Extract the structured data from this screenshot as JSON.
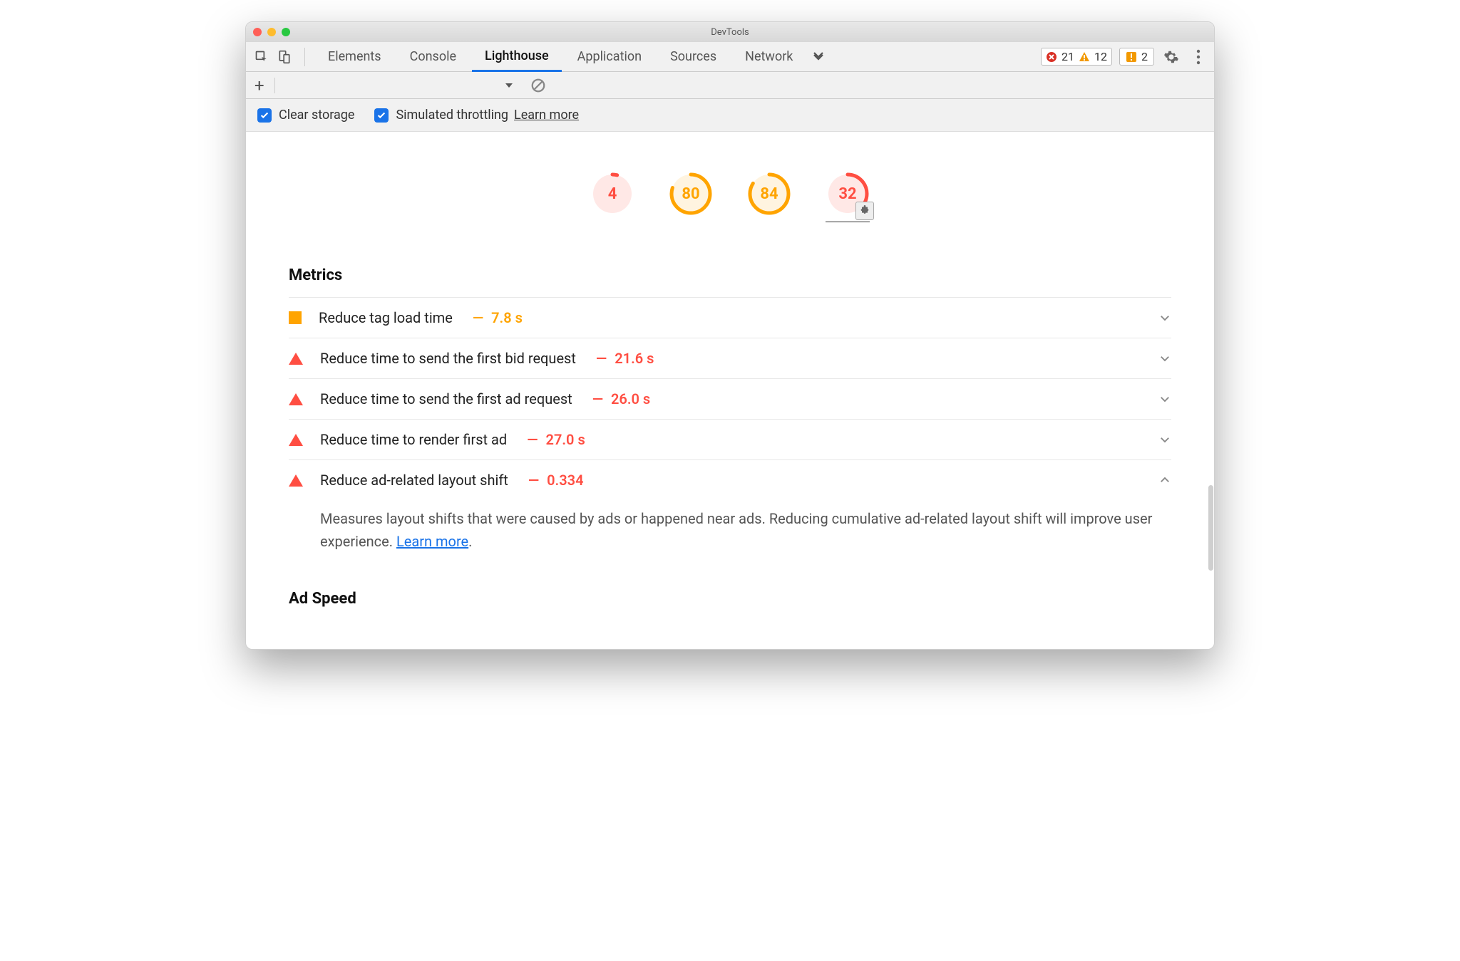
{
  "window": {
    "title": "DevTools"
  },
  "tabs": {
    "items": [
      "Elements",
      "Console",
      "Lighthouse",
      "Application",
      "Sources",
      "Network"
    ],
    "activeIndex": 2
  },
  "status": {
    "errors": "21",
    "warnings": "12",
    "issues": "2"
  },
  "options": {
    "clearStorage": "Clear storage",
    "simulatedThrottling": "Simulated throttling",
    "learnMore": "Learn more"
  },
  "scores": [
    {
      "value": "4",
      "level": "fail",
      "pct": 4
    },
    {
      "value": "80",
      "level": "avg",
      "pct": 80
    },
    {
      "value": "84",
      "level": "avg",
      "pct": 84
    },
    {
      "value": "32",
      "level": "fail",
      "pct": 32,
      "plugin": true,
      "underline": true
    }
  ],
  "sections": {
    "metricsTitle": "Metrics",
    "adSpeedTitle": "Ad Speed"
  },
  "metrics": [
    {
      "marker": "square",
      "title": "Reduce tag load time",
      "value": "7.8 s",
      "level": "avg",
      "expanded": false
    },
    {
      "marker": "triangle",
      "title": "Reduce time to send the first bid request",
      "value": "21.6 s",
      "level": "fail",
      "expanded": false
    },
    {
      "marker": "triangle",
      "title": "Reduce time to send the first ad request",
      "value": "26.0 s",
      "level": "fail",
      "expanded": false
    },
    {
      "marker": "triangle",
      "title": "Reduce time to render first ad",
      "value": "27.0 s",
      "level": "fail",
      "expanded": false
    },
    {
      "marker": "triangle",
      "title": "Reduce ad-related layout shift",
      "value": "0.334",
      "level": "fail",
      "expanded": true,
      "description": "Measures layout shifts that were caused by ads or happened near ads. Reducing cumulative ad-related layout shift will improve user experience. ",
      "descLink": "Learn more"
    }
  ]
}
